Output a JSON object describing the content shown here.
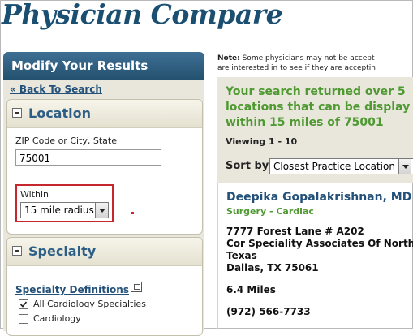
{
  "app_title": "Physician Compare",
  "sidebar": {
    "header": "Modify Your Results",
    "back_link": "« Back To Search",
    "location": {
      "title": "Location",
      "zip_label": "ZIP Code or City, State",
      "zip_value": "75001",
      "within_label": "Within",
      "within_value": "15 mile radius"
    },
    "specialty": {
      "title": "Specialty",
      "definitions_link": "Specialty Definitions",
      "options": [
        {
          "label": "All Cardiology Specialties",
          "checked": true
        },
        {
          "label": "Cardiology",
          "checked": false
        }
      ]
    }
  },
  "main": {
    "note_bold": "Note:",
    "note_line1": " Some physicians may not be accept",
    "note_line2": "are interested in to see if they are acceptin",
    "result_line1": "Your search returned over 5",
    "result_line2": "locations that can be display",
    "result_line3": "within 15 miles of 75001",
    "viewing": "Viewing 1 - 10",
    "sort_label": "Sort by",
    "sort_value": "Closest Practice Location",
    "result": {
      "name": "Deepika Gopalakrishnan, MD",
      "specialty": "Surgery - Cardiac",
      "address_line1": "7777 Forest Lane # A202",
      "address_line2": "Cor Speciality Associates Of North",
      "address_line3": "Texas",
      "address_line4": "Dallas, TX 75061",
      "distance": "6.4 Miles",
      "phone": "(972) 566-7733"
    }
  },
  "colors": {
    "title": "#1b4f72",
    "header_bg": "#2f6084",
    "panel_bg": "#e9e7dc",
    "result_text": "#4f9932",
    "highlight": "#c6262e"
  }
}
